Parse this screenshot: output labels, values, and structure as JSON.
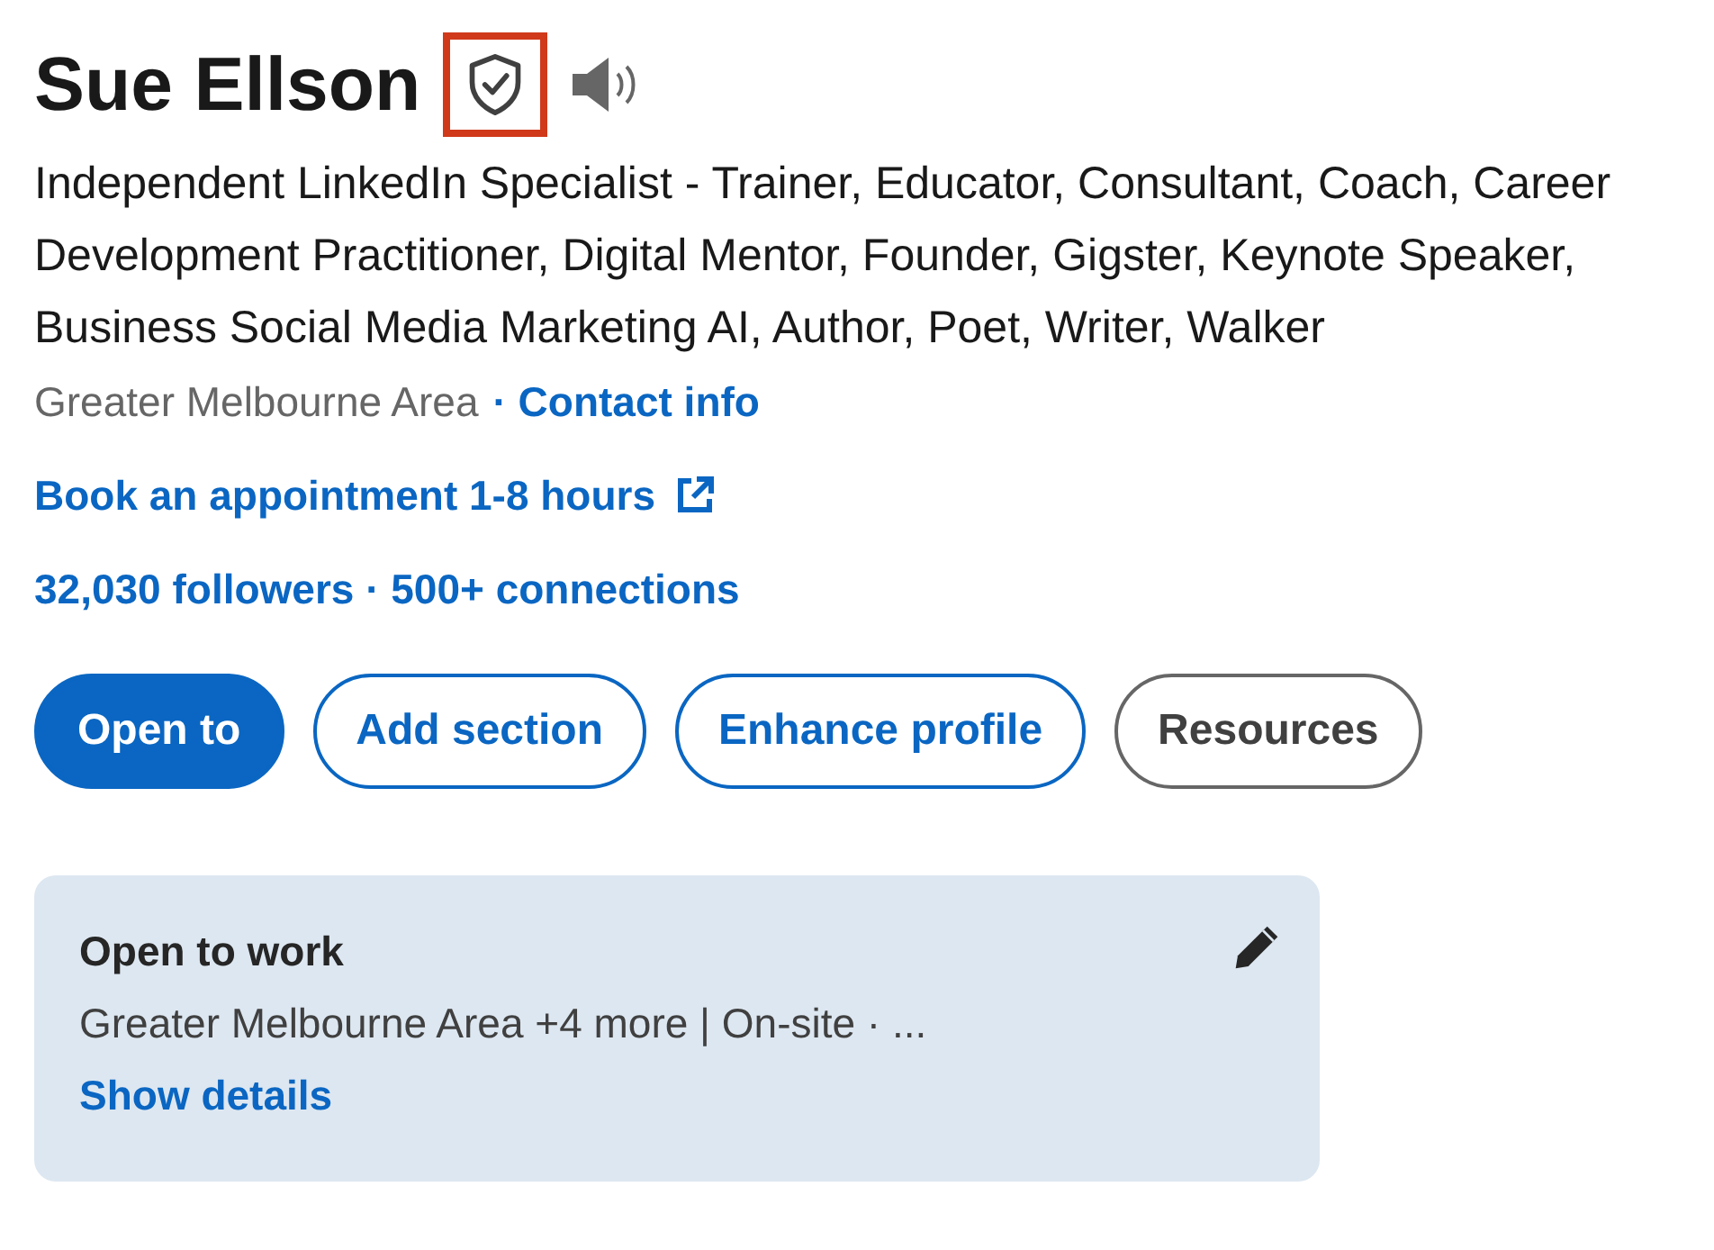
{
  "profile": {
    "name": "Sue Ellson",
    "verified_highlighted": true,
    "headline": "Independent LinkedIn Specialist - Trainer, Educator, Consultant, Coach, Career Development Practitioner, Digital Mentor, Founder, Gigster, Keynote Speaker, Business Social Media Marketing AI, Author, Poet, Writer, Walker",
    "location": "Greater Melbourne Area",
    "contact_link": "· Contact info",
    "booking_link": "Book an appointment 1-8 hours",
    "network": "32,030 followers · 500+ connections"
  },
  "buttons": [
    {
      "label": "Open to",
      "kind": "primary"
    },
    {
      "label": "Add section",
      "kind": "outline"
    },
    {
      "label": "Enhance profile",
      "kind": "outline"
    },
    {
      "label": "Resources",
      "kind": "neutral"
    }
  ],
  "open_to_work": {
    "title": "Open to work",
    "summary": "Greater Melbourne Area +4 more | On-site · ...",
    "link": "Show details"
  }
}
